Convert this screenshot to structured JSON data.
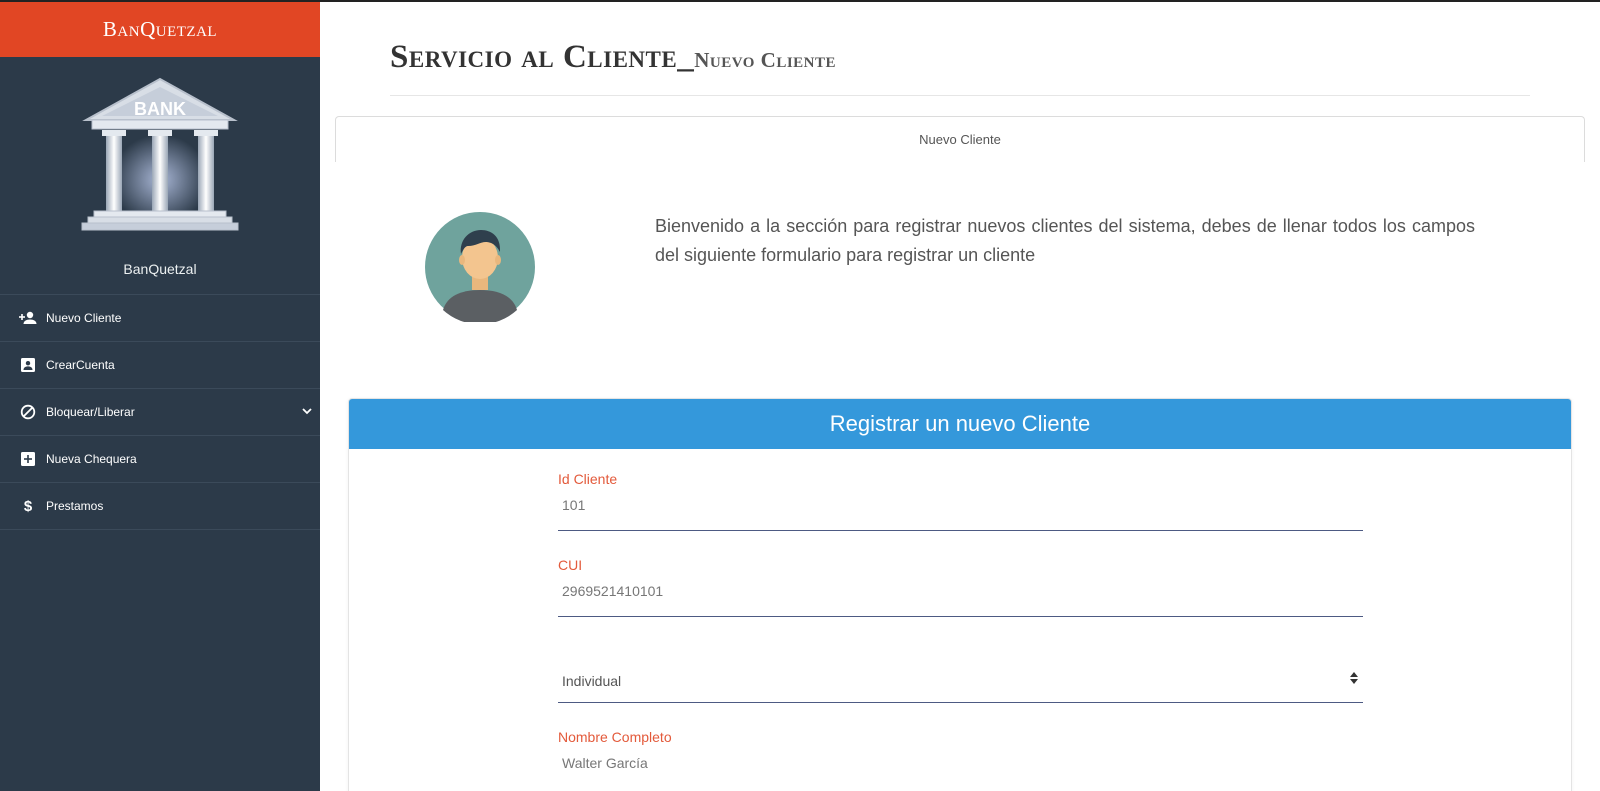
{
  "sidebar": {
    "brand": "BanQuetzal",
    "logo_text": "BANK",
    "bank_name": "BanQuetzal",
    "items": [
      {
        "label": "Nuevo Cliente",
        "icon": "person-add-icon"
      },
      {
        "label": "CrearCuenta",
        "icon": "account-box-icon"
      },
      {
        "label": "Bloquear/Liberar",
        "icon": "block-icon",
        "has_submenu": true
      },
      {
        "label": "Nueva Chequera",
        "icon": "add-box-icon"
      },
      {
        "label": "Prestamos",
        "icon": "dollar-icon"
      }
    ]
  },
  "header": {
    "title": "Servicio al Cliente_",
    "subtitle": "Nuevo Cliente"
  },
  "tab": {
    "label": "Nuevo Cliente"
  },
  "welcome_text": "Bienvenido a la sección para registrar nuevos clientes del sistema, debes de llenar todos los campos del siguiente formulario para registrar un cliente",
  "form": {
    "title": "Registrar un nuevo Cliente",
    "id_cliente": {
      "label": "Id Cliente",
      "value": "101"
    },
    "cui": {
      "label": "CUI",
      "value": "2969521410101"
    },
    "tipo": {
      "value": "Individual"
    },
    "nombre": {
      "label": "Nombre Completo",
      "value": "Walter García"
    }
  },
  "colors": {
    "brand": "#e14624",
    "sidebar": "#2c3a49",
    "card_header": "#3498db",
    "field_label": "#e35a3b"
  }
}
